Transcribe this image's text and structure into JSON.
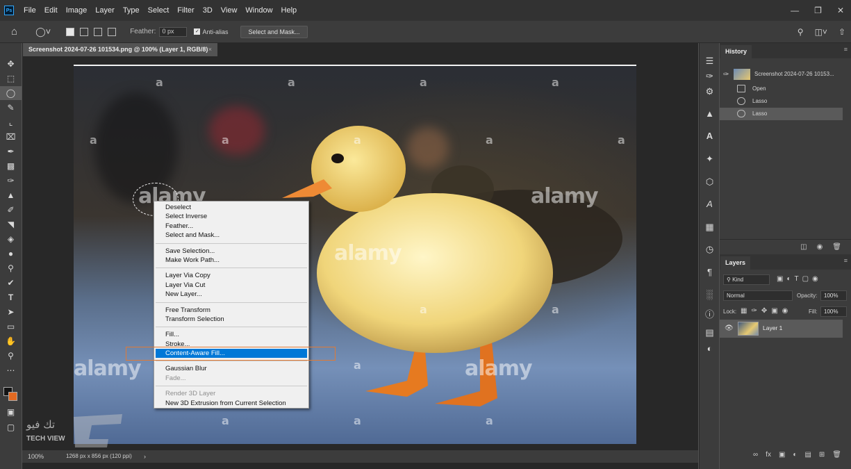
{
  "menubar": {
    "logo": "Ps",
    "items": [
      "File",
      "Edit",
      "Image",
      "Layer",
      "Type",
      "Select",
      "Filter",
      "3D",
      "View",
      "Window",
      "Help"
    ],
    "window_controls": [
      "minimize-icon",
      "restore-icon",
      "close-icon"
    ]
  },
  "options": {
    "feather_label": "Feather:",
    "feather_value": "0 px",
    "antialias_label": "Anti-alias",
    "antialias_checked": true,
    "select_mask_button": "Select and Mask...",
    "right_icons": [
      "search-icon",
      "workspace-icon",
      "share-icon"
    ]
  },
  "document": {
    "tab_title": "Screenshot 2024-07-26 101534.png @ 100% (Layer 1, RGB/8)",
    "tab_close": "×",
    "watermark_letter": "a",
    "watermark_word": "alamy"
  },
  "context_menu": {
    "groups": [
      [
        {
          "label": "Deselect"
        },
        {
          "label": "Select Inverse"
        },
        {
          "label": "Feather..."
        },
        {
          "label": "Select and Mask..."
        }
      ],
      [
        {
          "label": "Save Selection..."
        },
        {
          "label": "Make Work Path..."
        }
      ],
      [
        {
          "label": "Layer Via Copy"
        },
        {
          "label": "Layer Via Cut"
        },
        {
          "label": "New Layer..."
        }
      ],
      [
        {
          "label": "Free Transform"
        },
        {
          "label": "Transform Selection"
        }
      ],
      [
        {
          "label": "Fill..."
        },
        {
          "label": "Stroke..."
        },
        {
          "label": "Content-Aware Fill...",
          "highlighted": true
        }
      ],
      [
        {
          "label": "Gaussian Blur"
        },
        {
          "label": "Fade...",
          "disabled": true
        }
      ],
      [
        {
          "label": "Render 3D Layer",
          "disabled": true
        },
        {
          "label": "New 3D Extrusion from Current Selection"
        }
      ]
    ]
  },
  "status": {
    "zoom": "100%",
    "doc_info": "1268 px x 856 px (120 ppi)",
    "arrow": "›"
  },
  "logo": {
    "arabic_text": "تك فيو",
    "english_text": "TECH VIEW"
  },
  "history": {
    "title": "History",
    "snapshot": "Screenshot 2024-07-26 10153...",
    "steps": [
      {
        "label": "Open"
      },
      {
        "label": "Lasso"
      },
      {
        "label": "Lasso",
        "active": true
      }
    ]
  },
  "layers": {
    "title": "Layers",
    "kind_filter": "Kind",
    "blend_mode": "Normal",
    "opacity_label": "Opacity:",
    "opacity_value": "100%",
    "lock_label": "Lock:",
    "fill_label": "Fill:",
    "fill_value": "100%",
    "layer_name": "Layer 1"
  },
  "colors": {
    "foreground": "#141414",
    "background": "#e36a22",
    "highlight": "#0078d7",
    "annotation_box": "#e07a35"
  }
}
